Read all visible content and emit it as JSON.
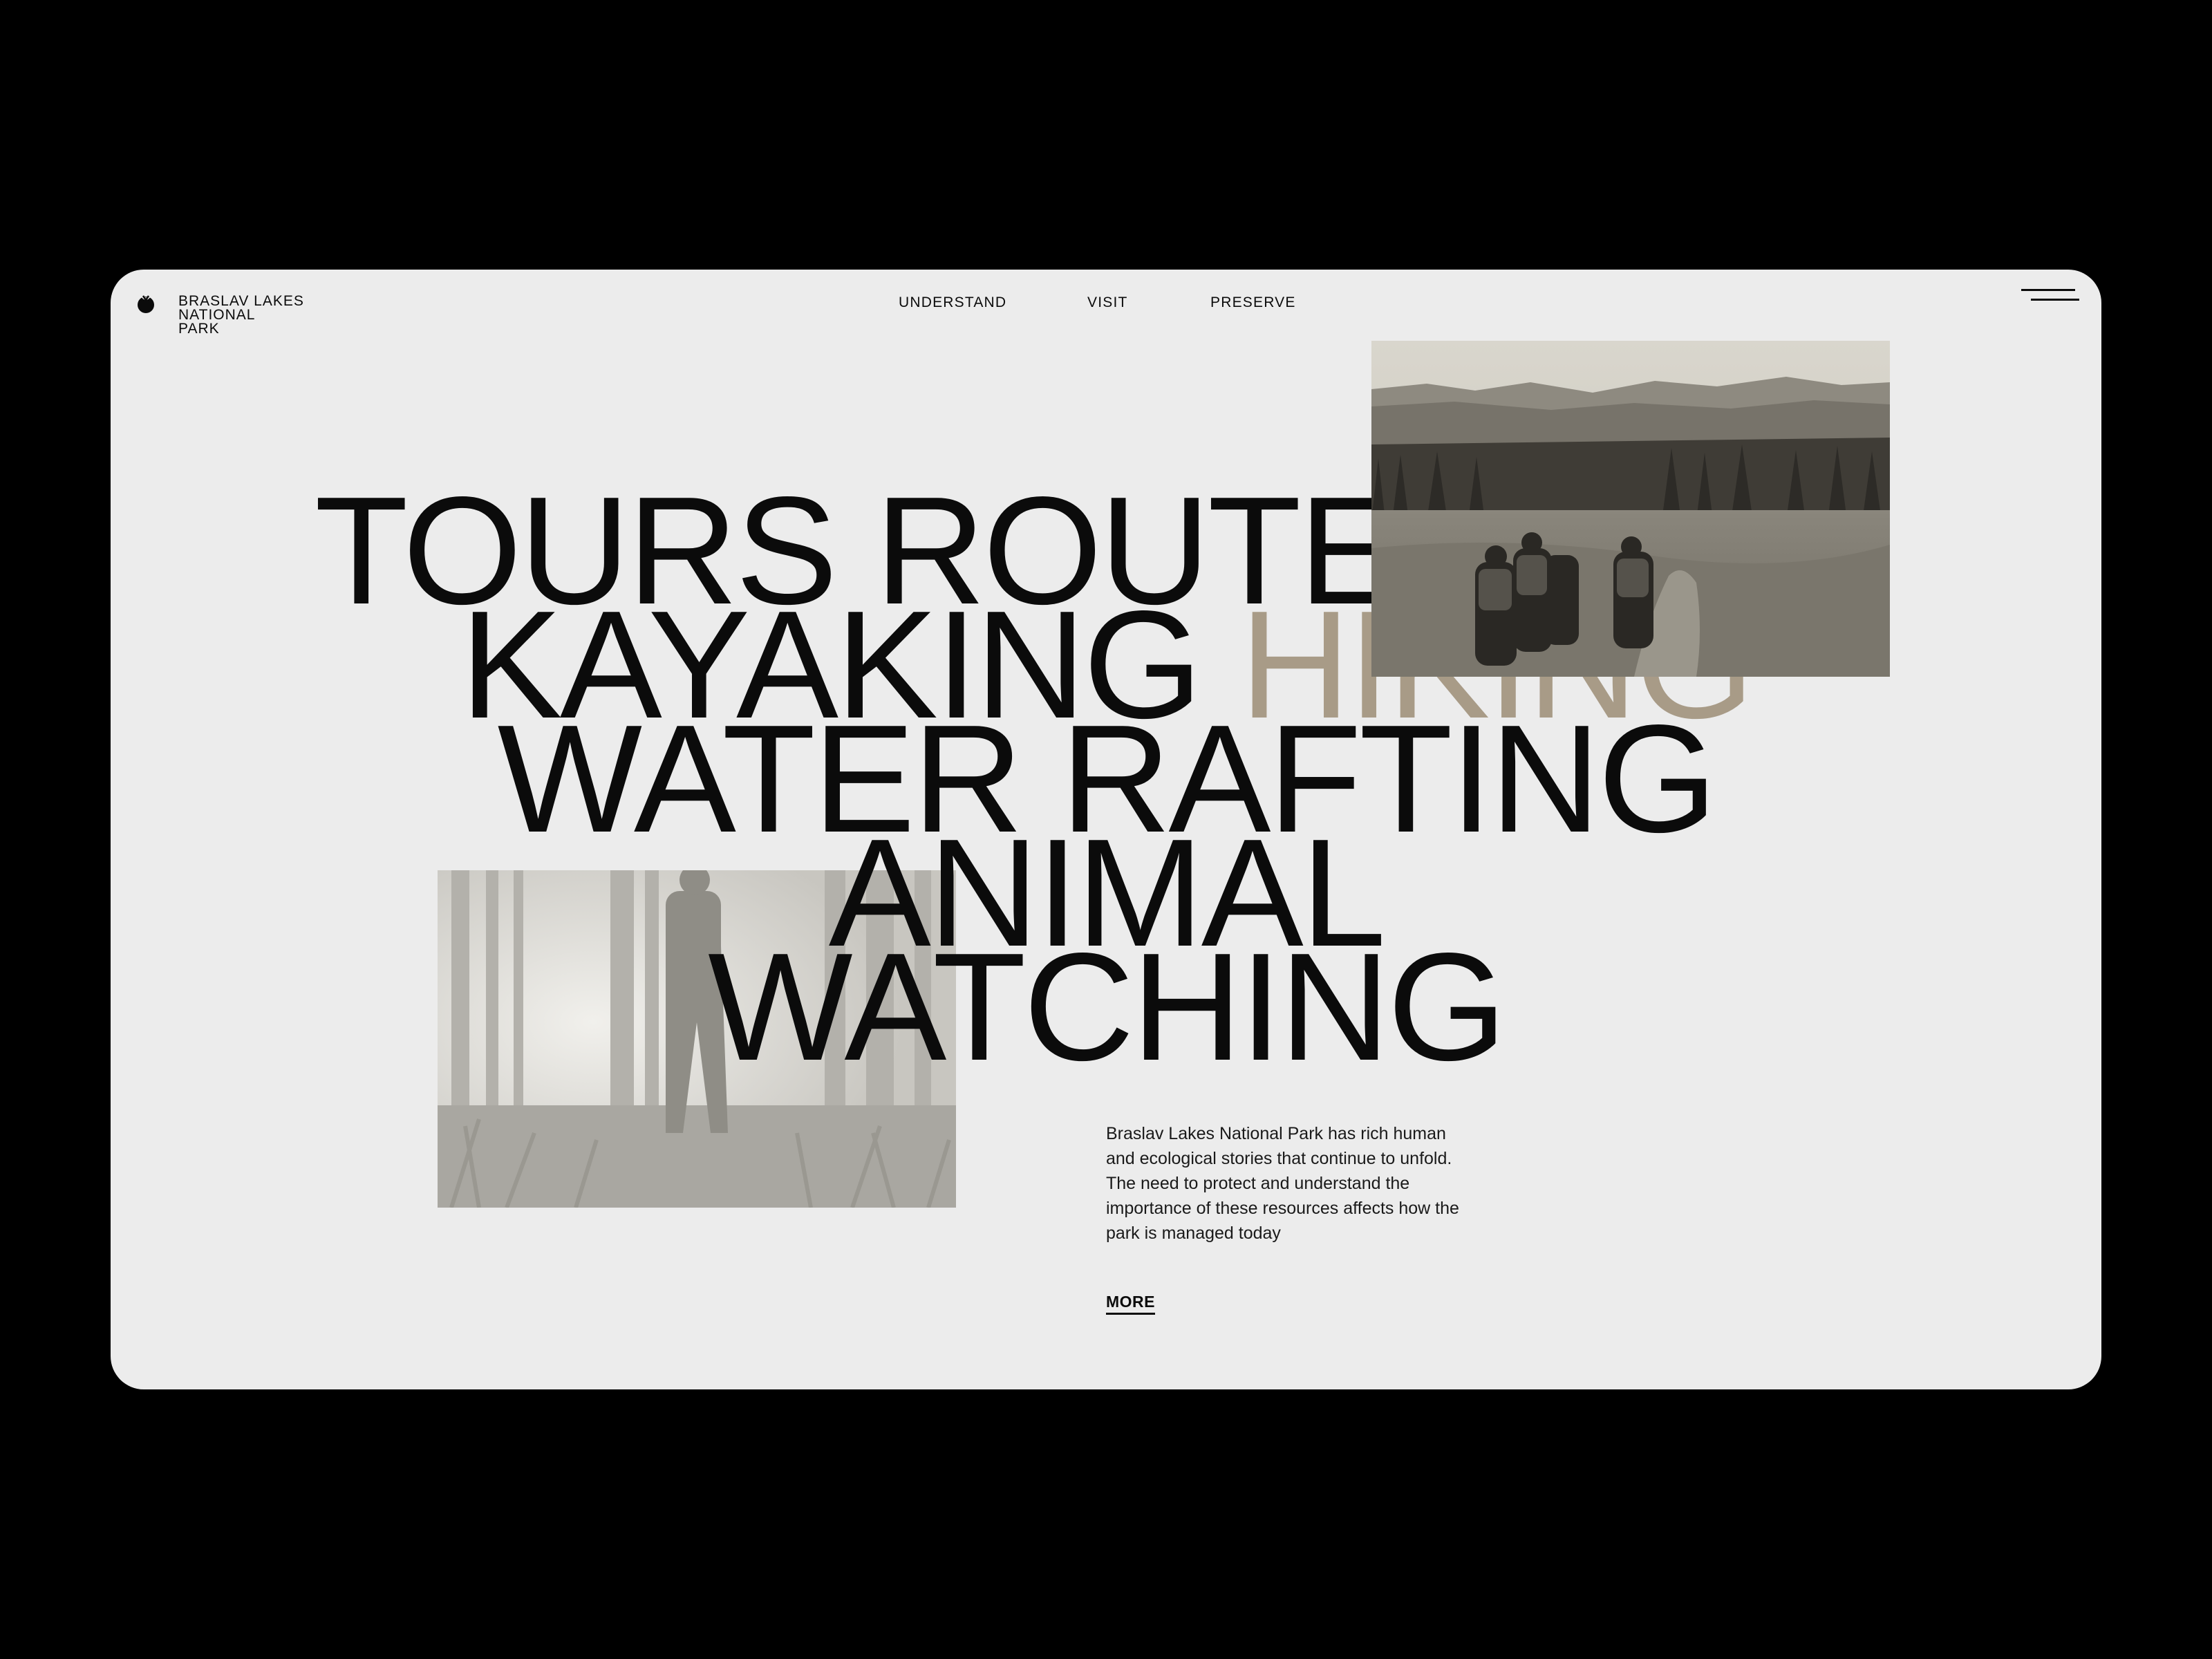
{
  "brand": {
    "logo_icon": "park-logo-icon",
    "name_line1": "BRASLAV LAKES",
    "name_line2": "NATIONAL",
    "name_line3": "PARK"
  },
  "nav": {
    "items": [
      {
        "label": "UNDERSTAND"
      },
      {
        "label": "VISIT"
      },
      {
        "label": "PRESERVE"
      }
    ],
    "menu_icon": "hamburger-menu-icon"
  },
  "hero": {
    "line1": "TOURS ROUTES",
    "line2_a": "KAYAKING",
    "line2_b": "HIKING",
    "line3": "WATER RAFTING",
    "line4": "ANIMAL",
    "line5": "WATCHING",
    "accent_color": "#a89b87"
  },
  "content": {
    "description": "Braslav Lakes National Park has rich human and ecological stories that continue to unfold. The need to protect and understand the importance of these resources affects how the park is managed today",
    "more_label": "MORE"
  },
  "colors": {
    "page_bg": "#000000",
    "card_bg": "#ececec",
    "text": "#0b0b0b"
  }
}
